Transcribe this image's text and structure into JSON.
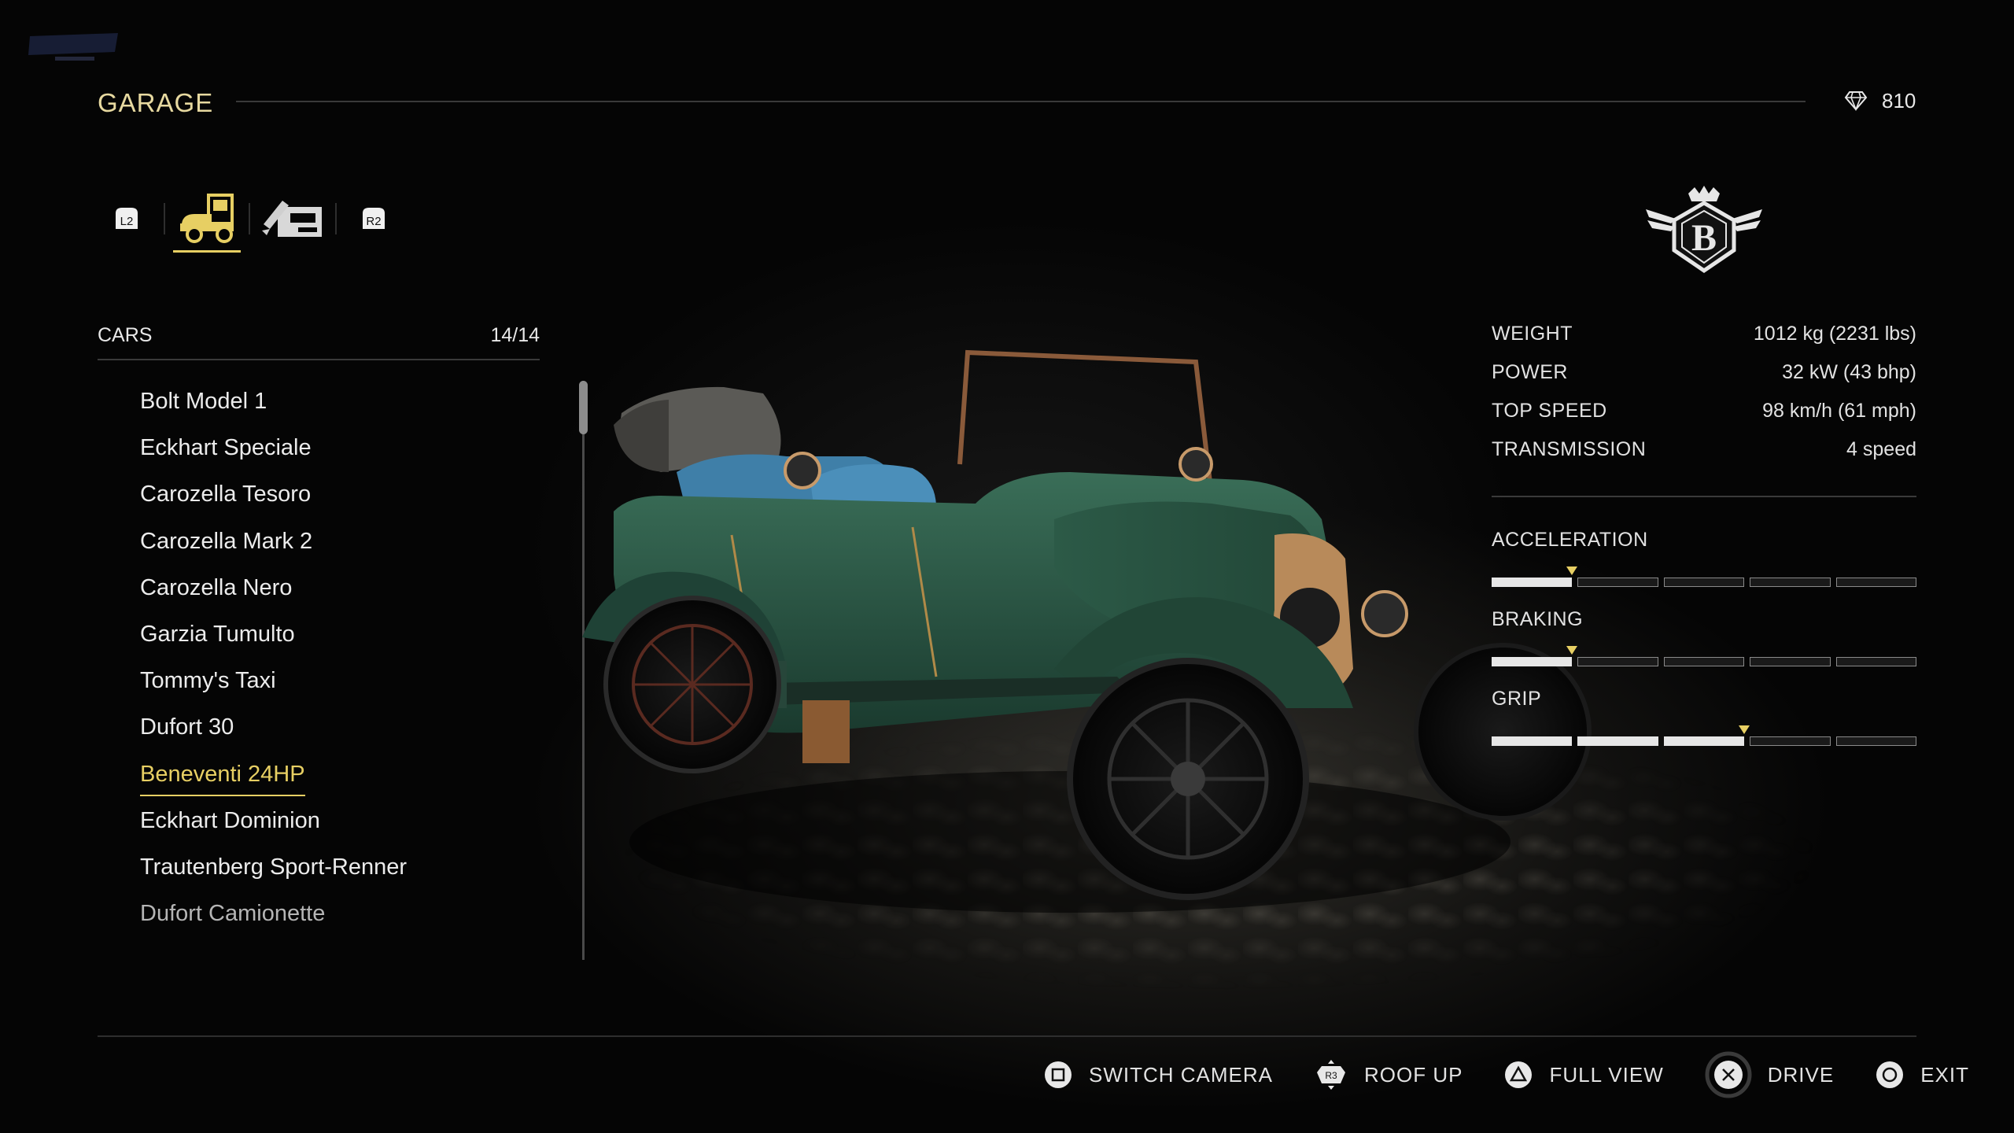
{
  "header": {
    "title": "GARAGE",
    "currency_icon": "diamond-icon",
    "currency_value": "810"
  },
  "tabs": [
    {
      "icon": "l2-button-icon",
      "label": "L2"
    },
    {
      "icon": "car-tab-icon",
      "active": true
    },
    {
      "icon": "customize-tab-icon"
    },
    {
      "icon": "r2-button-icon",
      "label": "R2"
    }
  ],
  "car_list": {
    "label": "CARS",
    "count": "14/14",
    "items": [
      "Bolt Model 1",
      "Eckhart Speciale",
      "Carozella Tesoro",
      "Carozella Mark 2",
      "Carozella Nero",
      "Garzia Tumulto",
      "Tommy's Taxi",
      "Dufort 30",
      "Beneventi 24HP",
      "Eckhart Dominion",
      "Trautenberg Sport-Renner",
      "Dufort Camionette"
    ],
    "selected_index": 8
  },
  "brand": {
    "icon": "beneventi-brand-badge"
  },
  "specs": [
    {
      "key": "WEIGHT",
      "value": "1012 kg (2231 lbs)"
    },
    {
      "key": "POWER",
      "value": "32 kW (43 bhp)"
    },
    {
      "key": "TOP SPEED",
      "value": "98 km/h (61 mph)"
    },
    {
      "key": "TRANSMISSION",
      "value": "4 speed"
    }
  ],
  "ratings": [
    {
      "label": "ACCELERATION",
      "filled_segments": 1,
      "total_segments": 5
    },
    {
      "label": "BRAKING",
      "filled_segments": 1,
      "total_segments": 5
    },
    {
      "label": "GRIP",
      "filled_segments": 3,
      "total_segments": 5
    }
  ],
  "actions": [
    {
      "icon": "square-button-icon",
      "label": "SWITCH CAMERA"
    },
    {
      "icon": "r3-button-icon",
      "label": "ROOF UP"
    },
    {
      "icon": "triangle-button-icon",
      "label": "FULL VIEW"
    },
    {
      "icon": "cross-button-icon",
      "label": "DRIVE"
    },
    {
      "icon": "circle-button-icon",
      "label": "EXIT"
    }
  ],
  "colors": {
    "accent": "#e7cf63",
    "car_body": "#2c5a47",
    "upholstery": "#3f7fa8"
  }
}
